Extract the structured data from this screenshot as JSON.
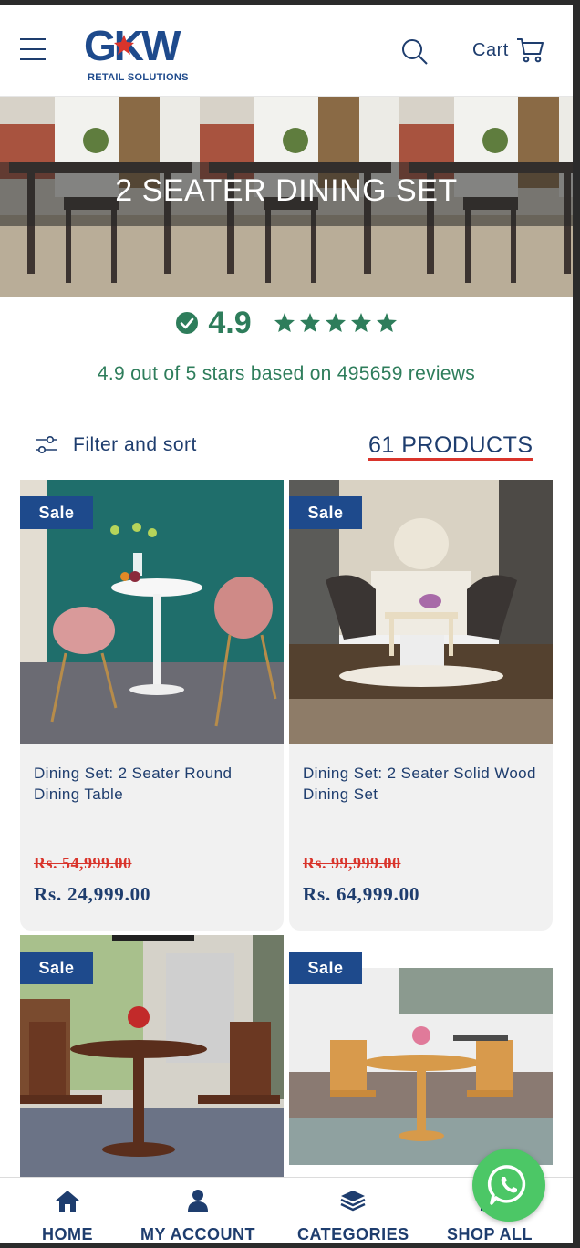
{
  "header": {
    "logo_text": "GKW",
    "logo_subtitle": "RETAIL SOLUTIONS",
    "cart_label": "Cart"
  },
  "banner": {
    "title": "2 SEATER DINING SET"
  },
  "rating": {
    "value": "4.9",
    "stars": 5,
    "summary": "4.9 out of 5 stars based on 495659 reviews"
  },
  "filter": {
    "label": "Filter and sort",
    "product_count": "61 PRODUCTS"
  },
  "products": [
    {
      "badge": "Sale",
      "title": "Dining Set: 2 Seater Round Dining Table",
      "old_price": "Rs. 54,999.00",
      "new_price": "Rs. 24,999.00"
    },
    {
      "badge": "Sale",
      "title": "Dining Set: 2 Seater Solid Wood Dining Set",
      "old_price": "Rs. 99,999.00",
      "new_price": "Rs. 64,999.00"
    },
    {
      "badge": "Sale"
    },
    {
      "badge": "Sale"
    }
  ],
  "bottom_nav": {
    "home": "HOME",
    "account": "MY ACCOUNT",
    "categories": "CATEGORIES",
    "shop_all": "SHOP ALL"
  },
  "colors": {
    "brand_blue": "#1e4a8c",
    "rating_green": "#2e7d5b",
    "sale_red": "#d9342b",
    "whatsapp_green": "#4cc766"
  }
}
